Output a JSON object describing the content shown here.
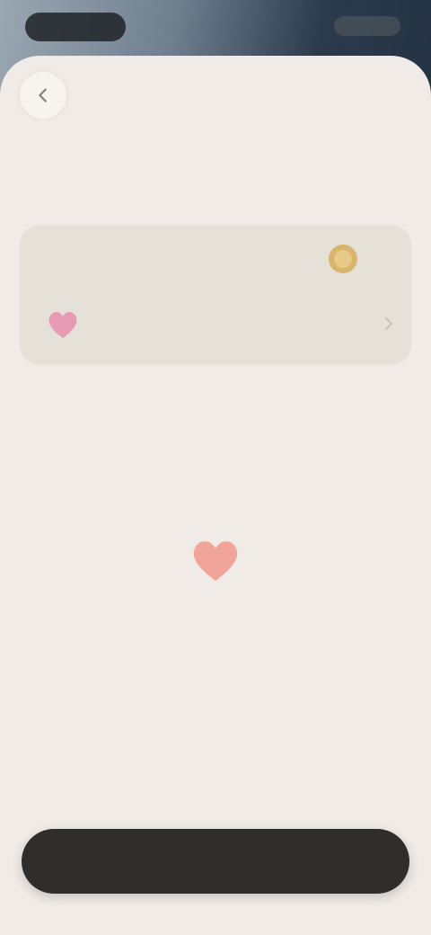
{
  "header": {
    "title": "",
    "back_icon": "chevron-left-icon"
  },
  "description": "",
  "picker_card": {
    "label": "",
    "coin_icon": "coin-icon",
    "selected_item": {
      "name": "",
      "icon": "heart-icon"
    }
  },
  "empty_state": {
    "icon": "heart-icon",
    "message": ""
  },
  "footer": {
    "button_label": ""
  },
  "colors": {
    "sheet_background": "#f0ebe6",
    "card_background": "#e5e1d8",
    "heart_pink": "#e89ab5",
    "heart_salmon": "#f0a49a",
    "coin_gold": "#d8b56a",
    "button_dark": "#2f2e2d"
  }
}
